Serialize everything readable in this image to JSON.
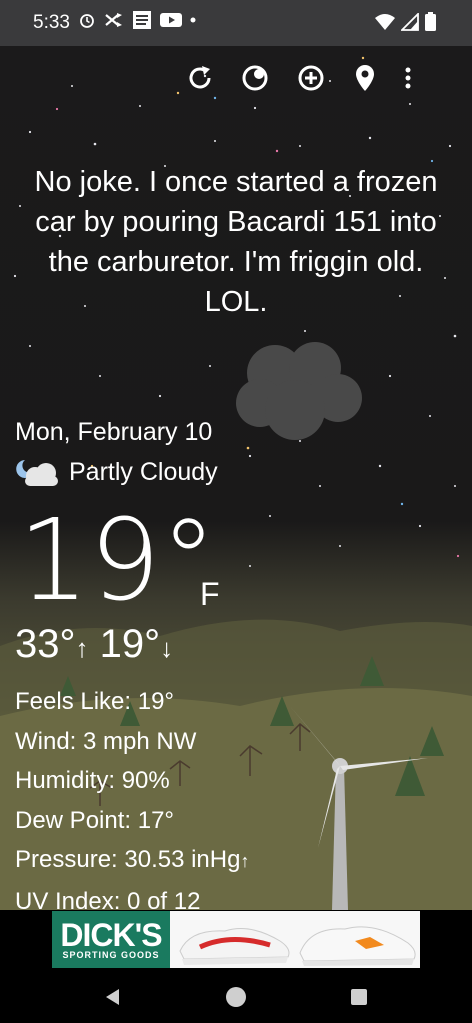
{
  "status": {
    "time": "5:33"
  },
  "quote": "No joke. I once started a frozen car by pouring Bacardi 151 into the carburetor. I'm friggin old. LOL.",
  "weather": {
    "date": "Mon, February 10",
    "condition": "Partly Cloudy",
    "temp": "19°",
    "unit": "F",
    "high": "33°",
    "low": "19°",
    "feels_like": "Feels Like:  19°",
    "wind": "Wind:  3 mph NW",
    "humidity": "Humidity:  90%",
    "dew_point": "Dew Point:  17°",
    "pressure": "Pressure:  30.53 inHg",
    "uv_index": "UV Index:  0 of 12"
  },
  "ad": {
    "brand_line1": "DICK'S",
    "brand_line2": "SPORTING GOODS"
  },
  "icons": [
    "alarm-icon",
    "shuffle-icon",
    "weather-channel-icon",
    "youtube-icon",
    "wifi-icon",
    "signal-icon",
    "battery-icon",
    "refresh-icon",
    "theme-icon",
    "add-location-icon",
    "location-pin-icon",
    "more-options-icon",
    "partly-cloudy-icon",
    "back-icon",
    "home-icon",
    "recents-icon"
  ]
}
